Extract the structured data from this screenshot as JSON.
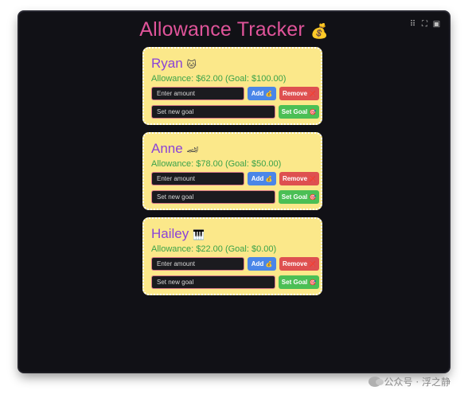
{
  "app": {
    "title": "Allowance Tracker",
    "title_emoji": "💰"
  },
  "toolbar": {
    "icons": [
      "grid-icon",
      "focus-icon",
      "image-icon"
    ]
  },
  "kids": [
    {
      "name": "Ryan",
      "emoji": "🐱",
      "allowance_text": "Allowance: $62.00 (Goal: $100.00)",
      "amount_placeholder": "Enter amount",
      "goal_placeholder": "Set new goal",
      "add_label": "Add",
      "remove_label": "Remove",
      "set_goal_label": "Set Goal"
    },
    {
      "name": "Anne",
      "emoji": "🏎",
      "allowance_text": "Allowance: $78.00 (Goal: $50.00)",
      "amount_placeholder": "Enter amount",
      "goal_placeholder": "Set new goal",
      "add_label": "Add",
      "remove_label": "Remove",
      "set_goal_label": "Set Goal"
    },
    {
      "name": "Hailey",
      "emoji": "🎹",
      "allowance_text": "Allowance: $22.00 (Goal: $0.00)",
      "amount_placeholder": "Enter amount",
      "goal_placeholder": "Set new goal",
      "add_label": "Add",
      "remove_label": "Remove",
      "set_goal_label": "Set Goal"
    }
  ],
  "button_emojis": {
    "add": "💰",
    "remove": "❌",
    "set_goal": "🎯"
  },
  "watermark": {
    "text": "公众号 · 浮之静"
  },
  "colors": {
    "title": "#e0549a",
    "name": "#8a43d8",
    "allowance": "#3aa24a",
    "card": "#fbe88a",
    "add": "#4a86e8",
    "remove": "#de5050",
    "set_goal": "#4bbf55",
    "background": "#111116"
  }
}
